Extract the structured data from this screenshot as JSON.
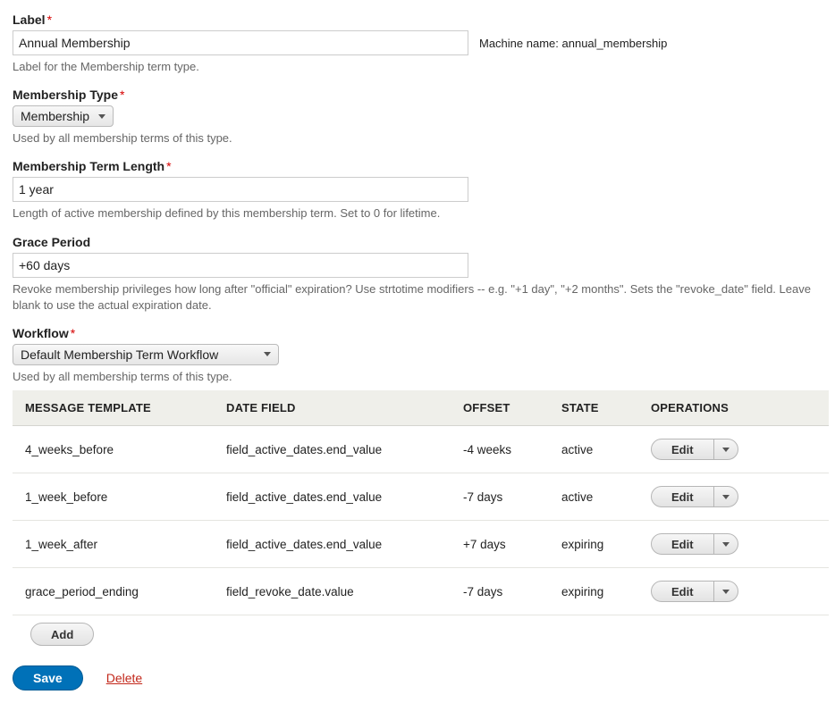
{
  "label": {
    "label": "Label",
    "value": "Annual Membership",
    "machine_prefix": "Machine name:",
    "machine_name": "annual_membership",
    "desc": "Label for the Membership term type."
  },
  "membership_type": {
    "label": "Membership Type",
    "value": "Membership",
    "desc": "Used by all membership terms of this type."
  },
  "term_length": {
    "label": "Membership Term Length",
    "value": "1 year",
    "desc": "Length of active membership defined by this membership term. Set to 0 for lifetime."
  },
  "grace": {
    "label": "Grace Period",
    "value": "+60 days",
    "desc": "Revoke membership privileges how long after \"official\" expiration? Use strtotime modifiers -- e.g. \"+1 day\", \"+2 months\". Sets the \"revoke_date\" field. Leave blank to use the actual expiration date."
  },
  "workflow": {
    "label": "Workflow",
    "value": "Default Membership Term Workflow",
    "desc": "Used by all membership terms of this type."
  },
  "table": {
    "headers": {
      "template": "MESSAGE TEMPLATE",
      "date_field": "DATE FIELD",
      "offset": "OFFSET",
      "state": "STATE",
      "ops": "OPERATIONS"
    },
    "edit_label": "Edit",
    "rows": [
      {
        "template": "4_weeks_before",
        "date_field": "field_active_dates.end_value",
        "offset": "-4 weeks",
        "state": "active"
      },
      {
        "template": "1_week_before",
        "date_field": "field_active_dates.end_value",
        "offset": "-7 days",
        "state": "active"
      },
      {
        "template": "1_week_after",
        "date_field": "field_active_dates.end_value",
        "offset": "+7 days",
        "state": "expiring"
      },
      {
        "template": "grace_period_ending",
        "date_field": "field_revoke_date.value",
        "offset": "-7 days",
        "state": "expiring"
      }
    ]
  },
  "buttons": {
    "add": "Add",
    "save": "Save",
    "delete": "Delete"
  }
}
